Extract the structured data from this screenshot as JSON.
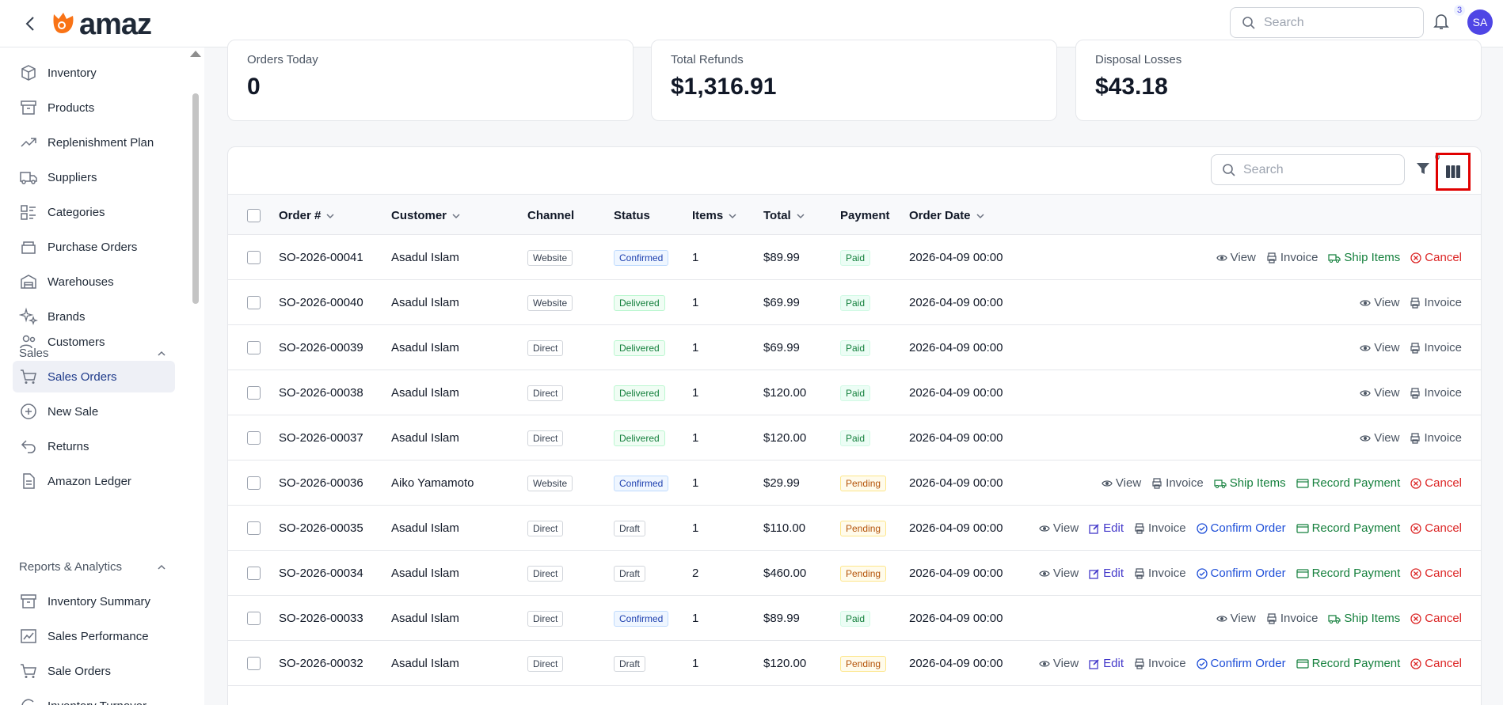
{
  "header": {
    "logo_text": "amaz",
    "search_placeholder": "Search",
    "notification_count": "3",
    "avatar_initials": "SA"
  },
  "sidebar": {
    "items_top": [
      {
        "label": "Inventory",
        "icon": "box-icon"
      },
      {
        "label": "Products",
        "icon": "archive-icon"
      },
      {
        "label": "Replenishment Plan",
        "icon": "trend-up-icon"
      },
      {
        "label": "Suppliers",
        "icon": "truck-icon"
      },
      {
        "label": "Categories",
        "icon": "category-icon"
      },
      {
        "label": "Purchase Orders",
        "icon": "purchase-icon"
      },
      {
        "label": "Warehouses",
        "icon": "warehouse-icon"
      },
      {
        "label": "Brands",
        "icon": "sparkle-icon"
      }
    ],
    "section_sales": "Sales",
    "items_sales": [
      {
        "label": "Customers",
        "icon": "users-icon"
      },
      {
        "label": "Sales Orders",
        "icon": "cart-icon"
      },
      {
        "label": "New Sale",
        "icon": "plus-circle-icon"
      },
      {
        "label": "Returns",
        "icon": "return-icon"
      },
      {
        "label": "Amazon Ledger",
        "icon": "document-icon"
      }
    ],
    "section_reports": "Reports & Analytics",
    "items_reports": [
      {
        "label": "Inventory Summary",
        "icon": "archive-icon"
      },
      {
        "label": "Sales Performance",
        "icon": "chart-icon"
      },
      {
        "label": "Sale Orders",
        "icon": "cart-icon"
      },
      {
        "label": "Inventory Turnover",
        "icon": "turnover-icon"
      }
    ]
  },
  "stats": [
    {
      "label": "Orders Today",
      "value": "0"
    },
    {
      "label": "Total Refunds",
      "value": "$1,316.91"
    },
    {
      "label": "Disposal Losses",
      "value": "$43.18"
    }
  ],
  "table": {
    "search_placeholder": "Search",
    "filter_count": "0",
    "headers": {
      "order": "Order #",
      "customer": "Customer",
      "channel": "Channel",
      "status": "Status",
      "items": "Items",
      "total": "Total",
      "payment": "Payment",
      "order_date": "Order Date"
    },
    "action_labels": {
      "view": "View",
      "edit": "Edit",
      "invoice": "Invoice",
      "confirm": "Confirm Order",
      "ship": "Ship Items",
      "record": "Record Payment",
      "cancel": "Cancel"
    },
    "rows": [
      {
        "order": "SO-2026-00041",
        "customer": "Asadul Islam",
        "channel": "Website",
        "status": "Confirmed",
        "items": "1",
        "total": "$89.99",
        "payment": "Paid",
        "date": "2026-04-09 00:00",
        "actions": [
          "view",
          "invoice",
          "ship",
          "cancel"
        ]
      },
      {
        "order": "SO-2026-00040",
        "customer": "Asadul Islam",
        "channel": "Website",
        "status": "Delivered",
        "items": "1",
        "total": "$69.99",
        "payment": "Paid",
        "date": "2026-04-09 00:00",
        "actions": [
          "view",
          "invoice"
        ]
      },
      {
        "order": "SO-2026-00039",
        "customer": "Asadul Islam",
        "channel": "Direct",
        "status": "Delivered",
        "items": "1",
        "total": "$69.99",
        "payment": "Paid",
        "date": "2026-04-09 00:00",
        "actions": [
          "view",
          "invoice"
        ]
      },
      {
        "order": "SO-2026-00038",
        "customer": "Asadul Islam",
        "channel": "Direct",
        "status": "Delivered",
        "items": "1",
        "total": "$120.00",
        "payment": "Paid",
        "date": "2026-04-09 00:00",
        "actions": [
          "view",
          "invoice"
        ]
      },
      {
        "order": "SO-2026-00037",
        "customer": "Asadul Islam",
        "channel": "Direct",
        "status": "Delivered",
        "items": "1",
        "total": "$120.00",
        "payment": "Paid",
        "date": "2026-04-09 00:00",
        "actions": [
          "view",
          "invoice"
        ]
      },
      {
        "order": "SO-2026-00036",
        "customer": "Aiko Yamamoto",
        "channel": "Website",
        "status": "Confirmed",
        "items": "1",
        "total": "$29.99",
        "payment": "Pending",
        "date": "2026-04-09 00:00",
        "actions": [
          "view",
          "invoice",
          "ship",
          "record",
          "cancel"
        ]
      },
      {
        "order": "SO-2026-00035",
        "customer": "Asadul Islam",
        "channel": "Direct",
        "status": "Draft",
        "items": "1",
        "total": "$110.00",
        "payment": "Pending",
        "date": "2026-04-09 00:00",
        "actions": [
          "view",
          "edit",
          "invoice",
          "confirm",
          "record",
          "cancel"
        ]
      },
      {
        "order": "SO-2026-00034",
        "customer": "Asadul Islam",
        "channel": "Direct",
        "status": "Draft",
        "items": "2",
        "total": "$460.00",
        "payment": "Pending",
        "date": "2026-04-09 00:00",
        "actions": [
          "view",
          "edit",
          "invoice",
          "confirm",
          "record",
          "cancel"
        ]
      },
      {
        "order": "SO-2026-00033",
        "customer": "Asadul Islam",
        "channel": "Direct",
        "status": "Confirmed",
        "items": "1",
        "total": "$89.99",
        "payment": "Paid",
        "date": "2026-04-09 00:00",
        "actions": [
          "view",
          "invoice",
          "ship",
          "cancel"
        ]
      },
      {
        "order": "SO-2026-00032",
        "customer": "Asadul Islam",
        "channel": "Direct",
        "status": "Draft",
        "items": "1",
        "total": "$120.00",
        "payment": "Pending",
        "date": "2026-04-09 00:00",
        "actions": [
          "view",
          "edit",
          "invoice",
          "confirm",
          "record",
          "cancel"
        ]
      }
    ]
  }
}
